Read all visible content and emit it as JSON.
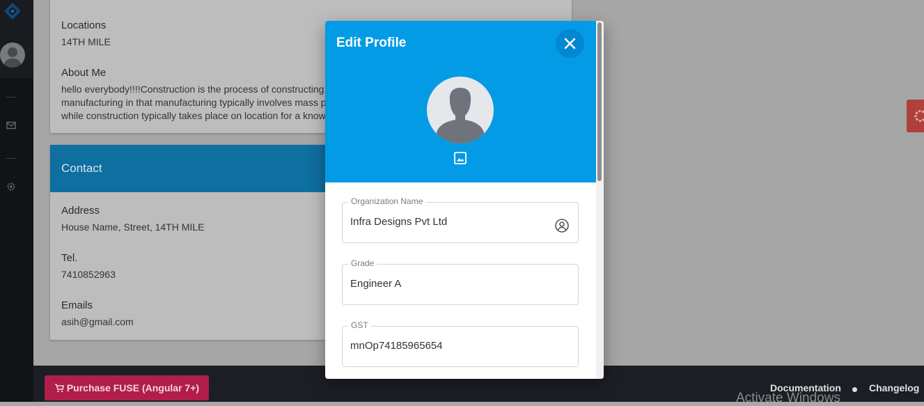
{
  "about_card": {
    "locations_label": "Locations",
    "locations_value": "14TH MILE",
    "about_label": "About Me",
    "about_text": "hello everybody!!!!Construction is the process of constructing a building or infrastructure. Construction differs from manufacturing in that manufacturing typically involves mass production of similar items without a designated purchaser, while construction typically takes place on location for a known client."
  },
  "contact_card": {
    "title": "Contact",
    "address_label": "Address",
    "address_value": "House Name, Street, 14TH MILE",
    "tel_label": "Tel.",
    "tel_value": "7410852963",
    "emails_label": "Emails",
    "emails_value": "asih@gmail.com"
  },
  "footer": {
    "purchase_label": "Purchase FUSE (Angular 7+)",
    "documentation_label": "Documentation",
    "changelog_label": "Changelog",
    "watermark": "Activate Windows"
  },
  "dialog": {
    "title": "Edit Profile",
    "fields": [
      {
        "label": "Organization Name",
        "value": "Infra Designs Pvt Ltd"
      },
      {
        "label": "Grade",
        "value": "Engineer A"
      },
      {
        "label": "GST",
        "value": "mnOp74185965654"
      }
    ]
  },
  "colors": {
    "dialog_header": "#039be5",
    "purchase_button": "#b11e4c",
    "sidebar": "#1b1e24"
  },
  "icons": [
    "logo-icon",
    "mail-icon",
    "settings-icon",
    "close-icon",
    "image-icon",
    "account-circle-icon",
    "cart-icon"
  ]
}
